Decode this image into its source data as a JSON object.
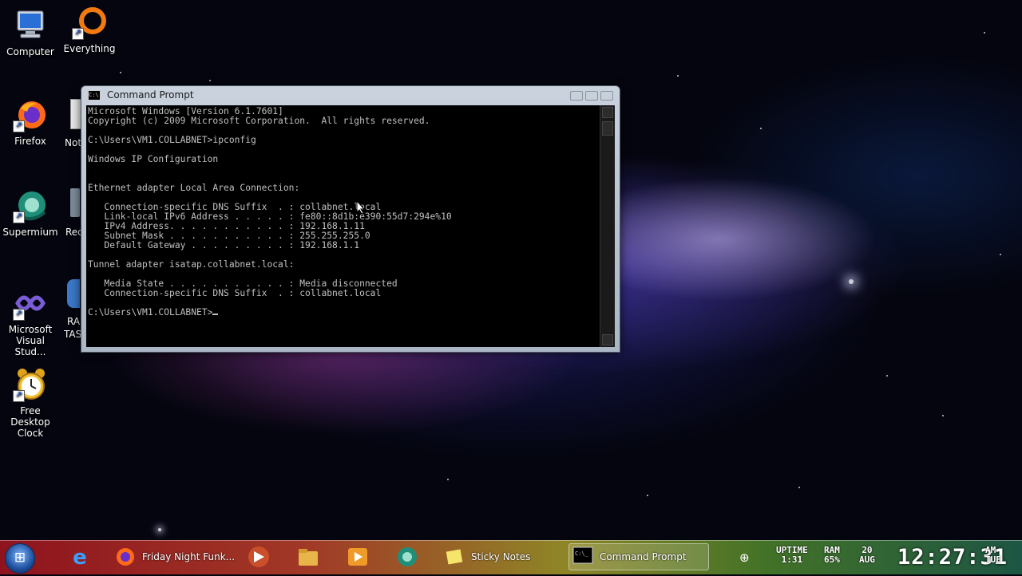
{
  "desktop": {
    "icons": [
      {
        "label": "Computer",
        "icon": "computer-icon"
      },
      {
        "label": "Everything",
        "icon": "everything-icon"
      },
      {
        "label": "Firefox",
        "icon": "firefox-icon"
      },
      {
        "label": "Supermium",
        "icon": "supermium-icon"
      },
      {
        "label": "Microsoft Visual Stud...",
        "icon": "visual-studio-icon"
      },
      {
        "label": "Free Desktop Clock",
        "icon": "alarm-clock-icon"
      }
    ],
    "partial_labels": [
      "Not",
      "Rec",
      "RA",
      "TAS"
    ]
  },
  "window": {
    "title": "Command Prompt",
    "console_lines": [
      "Microsoft Windows [Version 6.1.7601]",
      "Copyright (c) 2009 Microsoft Corporation.  All rights reserved.",
      "",
      "C:\\Users\\VM1.COLLABNET>ipconfig",
      "",
      "Windows IP Configuration",
      "",
      "",
      "Ethernet adapter Local Area Connection:",
      "",
      "   Connection-specific DNS Suffix  . : collabnet.local",
      "   Link-local IPv6 Address . . . . . : fe80::8d1b:e390:55d7:294e%10",
      "   IPv4 Address. . . . . . . . . . . : 192.168.1.11",
      "   Subnet Mask . . . . . . . . . . . : 255.255.255.0",
      "   Default Gateway . . . . . . . . . : 192.168.1.1",
      "",
      "Tunnel adapter isatap.collabnet.local:",
      "",
      "   Media State . . . . . . . . . . . : Media disconnected",
      "   Connection-specific DNS Suffix  . : collabnet.local",
      "",
      "C:\\Users\\VM1.COLLABNET>"
    ]
  },
  "taskbar": {
    "buttons": {
      "firefox": "Friday Night Funk...",
      "sticky_notes": "Sticky Notes",
      "command_prompt": "Command Prompt"
    },
    "tray": {
      "uptime_label": "UPTIME",
      "uptime_value": "1:31",
      "ram_label": "RAM",
      "ram_value": "65%",
      "date_day": "20",
      "date_month": "AUG",
      "time": "12:27:31",
      "ampm": "AM",
      "weekday": "TUE"
    }
  },
  "colors": {
    "console_bg": "#000000",
    "console_text": "#c0c0c0"
  }
}
